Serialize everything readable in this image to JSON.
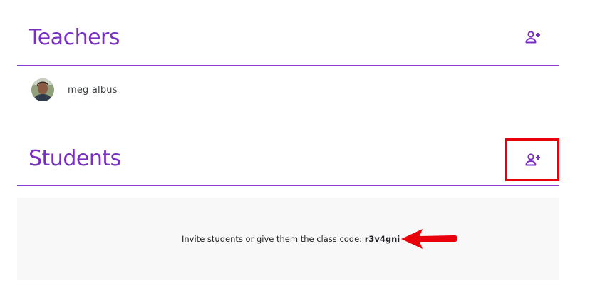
{
  "teachers": {
    "title": "Teachers",
    "add_icon": "person-add-icon",
    "list": [
      {
        "name": "meg albus",
        "avatar": "avatar-photo"
      }
    ]
  },
  "students": {
    "title": "Students",
    "add_icon": "person-add-icon",
    "invite_text": "Invite students or give them the class code: ",
    "class_code": "r3v4gni"
  },
  "annotations": {
    "highlight_color": "#e8000b",
    "arrow_color": "#e8000b"
  },
  "colors": {
    "accent": "#7a2fc4",
    "panel_background": "#f8f8f8"
  }
}
